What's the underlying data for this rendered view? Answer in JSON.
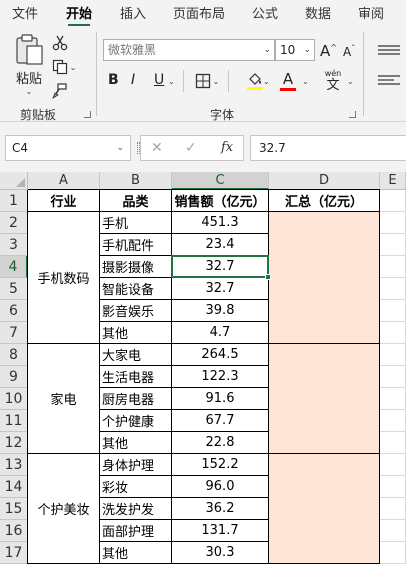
{
  "ribbon": {
    "tabs": [
      "文件",
      "开始",
      "插入",
      "页面布局",
      "公式",
      "数据",
      "审阅"
    ],
    "active_tab": "开始",
    "clipboard": {
      "paste_label": "粘贴",
      "group_label": "剪贴板"
    },
    "font": {
      "font_name": "微软雅黑",
      "font_size": "10",
      "bold": "B",
      "italic": "I",
      "underline": "U",
      "grow": "A",
      "shrink": "A",
      "font_color_glyph": "A",
      "phonetic_top": "wén",
      "phonetic_bottom": "文",
      "group_label": "字体"
    },
    "colors": {
      "fill": "#ffff00",
      "font": "#ff0000",
      "accent": "#217346"
    }
  },
  "formula_bar": {
    "name_box": "C4",
    "cancel_glyph": "✕",
    "enter_glyph": "✓",
    "fx_label": "fx",
    "value": "32.7"
  },
  "sheet": {
    "columns": [
      "A",
      "B",
      "C",
      "D",
      "E"
    ],
    "rows": [
      "1",
      "2",
      "3",
      "4",
      "5",
      "6",
      "7",
      "8",
      "9",
      "10",
      "11",
      "12",
      "13",
      "14",
      "15",
      "16",
      "17"
    ],
    "selected_cell": "C4",
    "headers": {
      "industry": "行业",
      "category": "品类",
      "sales": "销售额（亿元）",
      "total": "汇总（亿元）"
    },
    "groups": [
      {
        "industry": "手机数码",
        "items": [
          {
            "category": "手机",
            "sales": "451.3"
          },
          {
            "category": "手机配件",
            "sales": "23.4"
          },
          {
            "category": "摄影摄像",
            "sales": "32.7"
          },
          {
            "category": "智能设备",
            "sales": "32.7"
          },
          {
            "category": "影音娱乐",
            "sales": "39.8"
          },
          {
            "category": "其他",
            "sales": "4.7"
          }
        ]
      },
      {
        "industry": "家电",
        "items": [
          {
            "category": "大家电",
            "sales": "264.5"
          },
          {
            "category": "生活电器",
            "sales": "122.3"
          },
          {
            "category": "厨房电器",
            "sales": "91.6"
          },
          {
            "category": "个护健康",
            "sales": "67.7"
          },
          {
            "category": "其他",
            "sales": "22.8"
          }
        ]
      },
      {
        "industry": "个护美妆",
        "items": [
          {
            "category": "身体护理",
            "sales": "152.2"
          },
          {
            "category": "彩妆",
            "sales": "96.0"
          },
          {
            "category": "洗发护发",
            "sales": "36.2"
          },
          {
            "category": "面部护理",
            "sales": "131.7"
          },
          {
            "category": "其他",
            "sales": "30.3"
          }
        ]
      }
    ],
    "total_fill": "#fce4d6"
  }
}
